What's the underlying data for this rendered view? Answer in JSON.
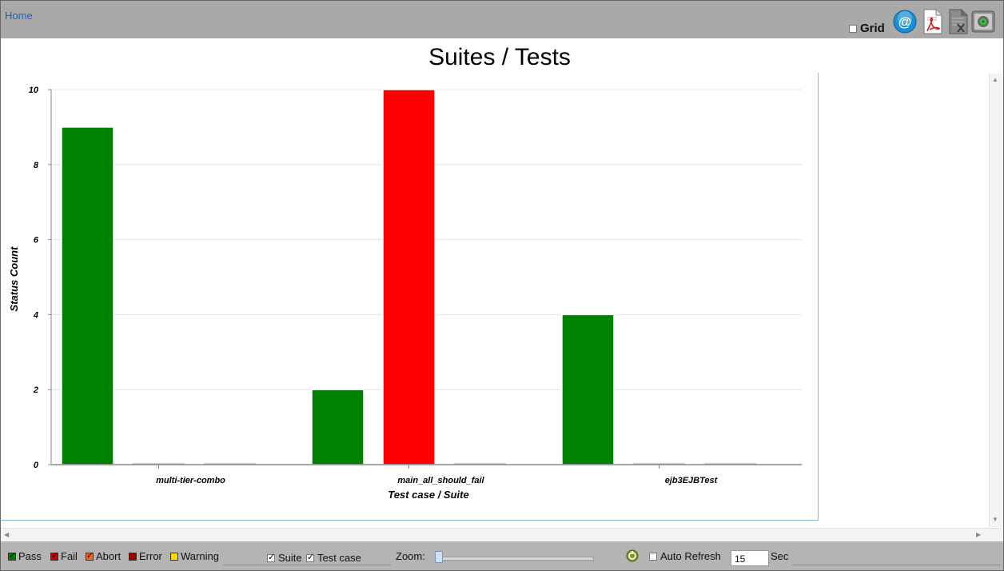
{
  "header": {
    "home_link": "Home",
    "grid_label": "Grid",
    "grid_checked": false,
    "icons": [
      "email-icon",
      "pdf-export-icon",
      "excel-export-icon",
      "settings-disk-icon"
    ]
  },
  "colors": {
    "pass": "#008000",
    "fail": "#ff0000",
    "abort": "#ff6600",
    "error": "#990000",
    "warning": "#ffff00"
  },
  "chart_data": {
    "type": "bar",
    "title": "Suites / Tests",
    "xlabel": "Test case / Suite",
    "ylabel": "Status Count",
    "ylim": [
      0,
      10
    ],
    "yticks": [
      0,
      2,
      4,
      6,
      8,
      10
    ],
    "grid": true,
    "categories": [
      "multi-tier-combo",
      "main_all_should_fail",
      "ejb3EJBTest"
    ],
    "series": [
      {
        "name": "Pass",
        "color": "#008000",
        "values": [
          9,
          2,
          4
        ]
      },
      {
        "name": "Fail",
        "color": "#ff0000",
        "values": [
          0,
          10,
          0
        ]
      },
      {
        "name": "Abort",
        "color": "#ff6600",
        "values": [
          0,
          0,
          0
        ]
      }
    ]
  },
  "footer": {
    "legend": [
      {
        "label": "Pass",
        "color": "#008000",
        "checked": true
      },
      {
        "label": "Fail",
        "color": "#cc0000",
        "checked": true
      },
      {
        "label": "Abort",
        "color": "#ff6600",
        "checked": true
      },
      {
        "label": "Error",
        "color": "#990000",
        "checked": false
      },
      {
        "label": "Warning",
        "color": "#ffdd00",
        "checked": false
      }
    ],
    "suite_label": "Suite",
    "suite_checked": true,
    "testcase_label": "Test case",
    "testcase_checked": true,
    "zoom_label": "Zoom:",
    "auto_refresh_label": "Auto Refresh",
    "auto_refresh_checked": false,
    "refresh_value": "15",
    "refresh_unit": "Sec"
  }
}
